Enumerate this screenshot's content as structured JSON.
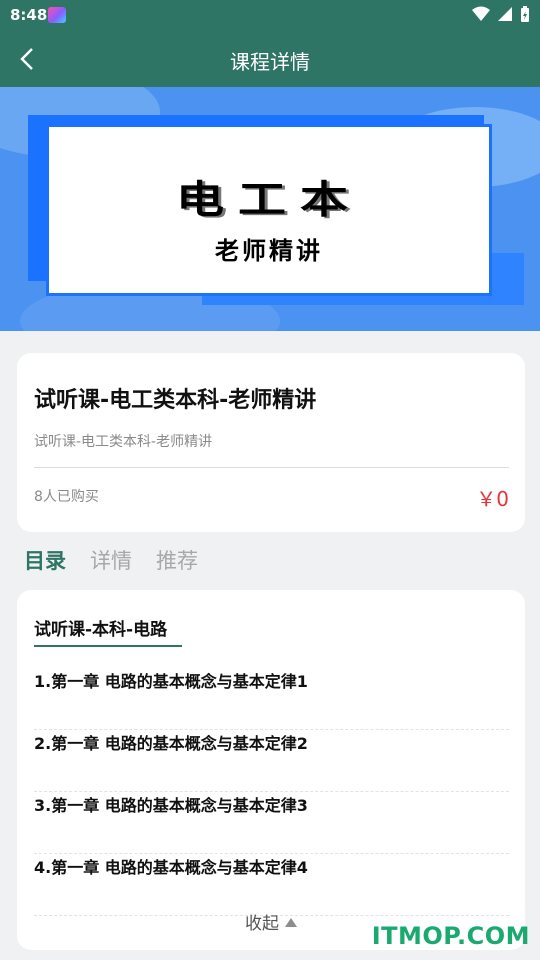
{
  "status": {
    "time": "8:48"
  },
  "appbar": {
    "title": "课程详情"
  },
  "banner": {
    "title": "电工本",
    "subtitle": "老师精讲"
  },
  "course": {
    "title": "试听课-电工类本科-老师精讲",
    "subtitle": "试听课-电工类本科-老师精讲",
    "buyers": "8人已购买",
    "price": "￥0"
  },
  "tabs": [
    {
      "label": "目录",
      "active": true
    },
    {
      "label": "详情",
      "active": false
    },
    {
      "label": "推荐",
      "active": false
    }
  ],
  "catalog": {
    "section_title": "试听课-本科-电路",
    "lessons": [
      "1.第一章 电路的基本概念与基本定律1",
      "2.第一章 电路的基本概念与基本定律2",
      "3.第一章 电路的基本概念与基本定律3",
      "4.第一章 电路的基本概念与基本定律4"
    ],
    "collapse_label": "收起"
  },
  "watermark": "ITMOP.COM",
  "colors": {
    "header": "#2f7566",
    "price": "#e5353c",
    "banner_blue": "#4c92f0",
    "watermark": "#1aaa70"
  }
}
